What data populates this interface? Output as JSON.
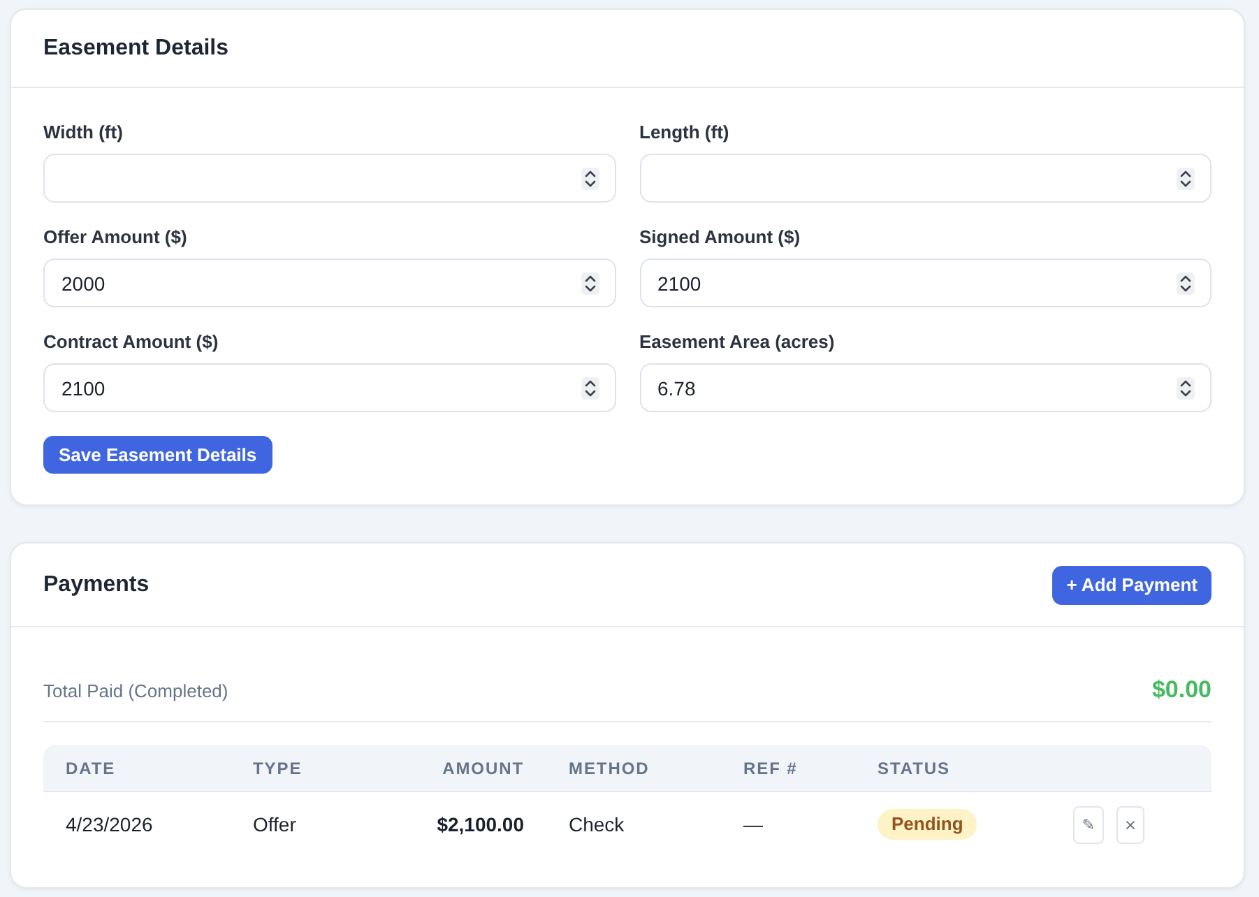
{
  "easement_details": {
    "title": "Easement Details",
    "fields": [
      {
        "label": "Width (ft)"
      },
      {
        "label": "Length (ft)"
      },
      {
        "label": "Offer Amount ($)",
        "value": "2000"
      },
      {
        "label": "Signed Amount ($)",
        "value": "2100"
      },
      {
        "label": "Contract Amount ($)",
        "value": "2100"
      },
      {
        "label": "Easement Area (acres)",
        "value": "6.78"
      }
    ],
    "save_button": "Save Easement Details"
  },
  "payments": {
    "title": "Payments",
    "add_button": "+ Add Payment",
    "total": {
      "label": "Total Paid (Completed)",
      "amount": "$0.00"
    },
    "table": {
      "columns": [
        "DATE",
        "TYPE",
        "AMOUNT",
        "METHOD",
        "REF #",
        "STATUS"
      ],
      "rows": [
        {
          "date": "4/23/2026",
          "type": "Offer",
          "amount": "$2,100.00",
          "method": "Check",
          "ref": "—",
          "status": "Pending",
          "actions": [
            "✎",
            "×"
          ]
        }
      ]
    }
  }
}
